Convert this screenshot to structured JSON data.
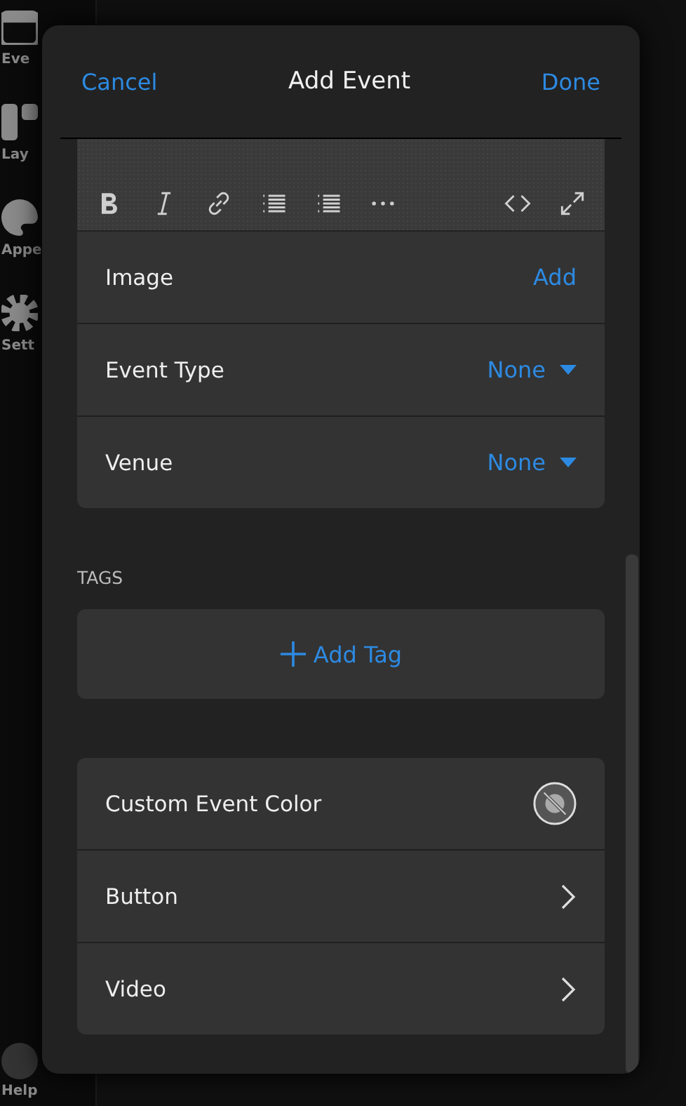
{
  "sidebar": {
    "items": [
      {
        "label": "Eve"
      },
      {
        "label": "Lay"
      },
      {
        "label": "Appe"
      },
      {
        "label": "Sett"
      }
    ],
    "help": {
      "label": "Help"
    }
  },
  "dialog": {
    "cancel": "Cancel",
    "title": "Add Event",
    "done": "Done",
    "details": [
      {
        "label": "Image",
        "kind": "action",
        "value": "Add"
      },
      {
        "label": "Event Type",
        "kind": "dropdown",
        "value": "None"
      },
      {
        "label": "Venue",
        "kind": "dropdown",
        "value": "None"
      }
    ],
    "tags_heading": "TAGS",
    "add_tag": "Add Tag",
    "options": [
      {
        "label": "Custom Event Color",
        "kind": "color"
      },
      {
        "label": "Button",
        "kind": "link"
      },
      {
        "label": "Video",
        "kind": "link"
      }
    ]
  }
}
